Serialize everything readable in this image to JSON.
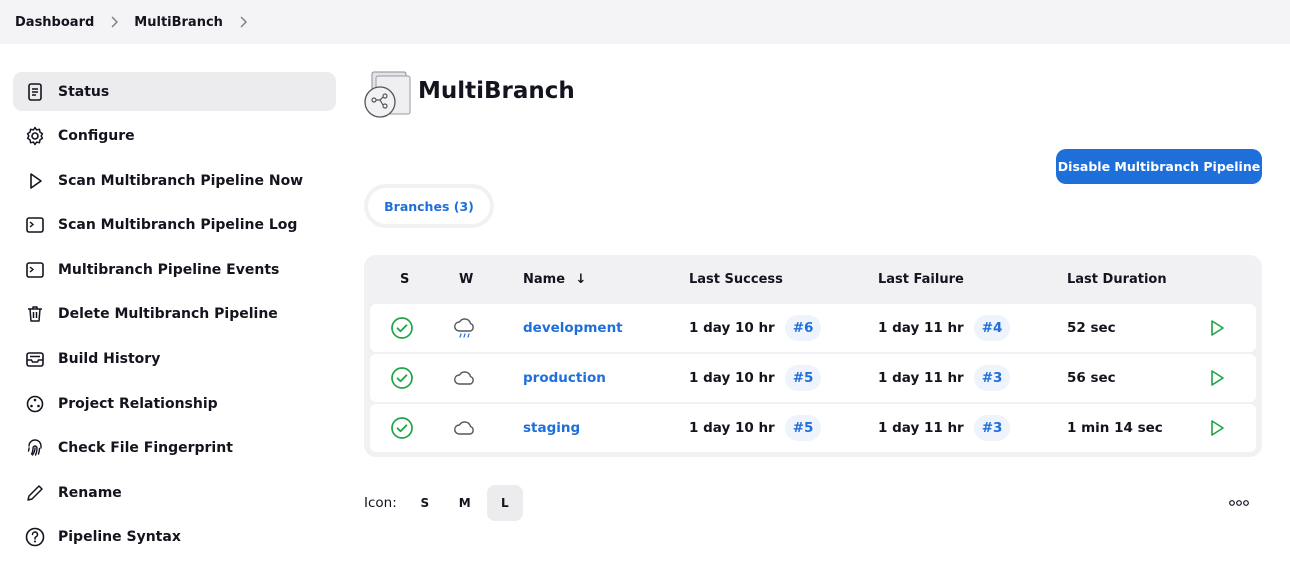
{
  "breadcrumb": {
    "items": [
      "Dashboard",
      "MultiBranch"
    ]
  },
  "sidebar": {
    "items": [
      {
        "label": "Status",
        "icon": "document-icon",
        "active": true
      },
      {
        "label": "Configure",
        "icon": "gear-icon"
      },
      {
        "label": "Scan Multibranch Pipeline Now",
        "icon": "play-icon"
      },
      {
        "label": "Scan Multibranch Pipeline Log",
        "icon": "terminal-icon"
      },
      {
        "label": "Multibranch Pipeline Events",
        "icon": "terminal-icon"
      },
      {
        "label": "Delete Multibranch Pipeline",
        "icon": "trash-icon"
      },
      {
        "label": "Build History",
        "icon": "inbox-icon"
      },
      {
        "label": "Project Relationship",
        "icon": "relationship-icon"
      },
      {
        "label": "Check File Fingerprint",
        "icon": "fingerprint-icon"
      },
      {
        "label": "Rename",
        "icon": "pencil-icon"
      },
      {
        "label": "Pipeline Syntax",
        "icon": "help-icon"
      }
    ]
  },
  "page": {
    "title": "MultiBranch",
    "icon": "multibranch-folder-icon"
  },
  "actions": {
    "disable_label": "Disable Multibranch Pipeline"
  },
  "tabs": [
    {
      "label": "Branches (3)"
    }
  ],
  "table": {
    "headers": {
      "s": "S",
      "w": "W",
      "name": "Name",
      "name_sort": "↓",
      "last_success": "Last Success",
      "last_failure": "Last Failure",
      "last_duration": "Last Duration"
    },
    "rows": [
      {
        "status": "success",
        "weather": "rain-cloud-icon",
        "name": "development",
        "last_success": "1 day 10 hr",
        "success_build": "#6",
        "last_failure": "1 day 11 hr",
        "failure_build": "#4",
        "duration": "52 sec"
      },
      {
        "status": "success",
        "weather": "cloud-icon",
        "name": "production",
        "last_success": "1 day 10 hr",
        "success_build": "#5",
        "last_failure": "1 day 11 hr",
        "failure_build": "#3",
        "duration": "56 sec"
      },
      {
        "status": "success",
        "weather": "cloud-icon",
        "name": "staging",
        "last_success": "1 day 10 hr",
        "success_build": "#5",
        "last_failure": "1 day 11 hr",
        "failure_build": "#3",
        "duration": "1 min 14 sec"
      }
    ]
  },
  "icon_size": {
    "label": "Icon:",
    "options": [
      "S",
      "M",
      "L"
    ],
    "selected": "L"
  },
  "colors": {
    "accent": "#1f6fdb",
    "success": "#1ea446",
    "badge_bg": "#eef3fc",
    "header_bg": "#f4f4f6"
  }
}
